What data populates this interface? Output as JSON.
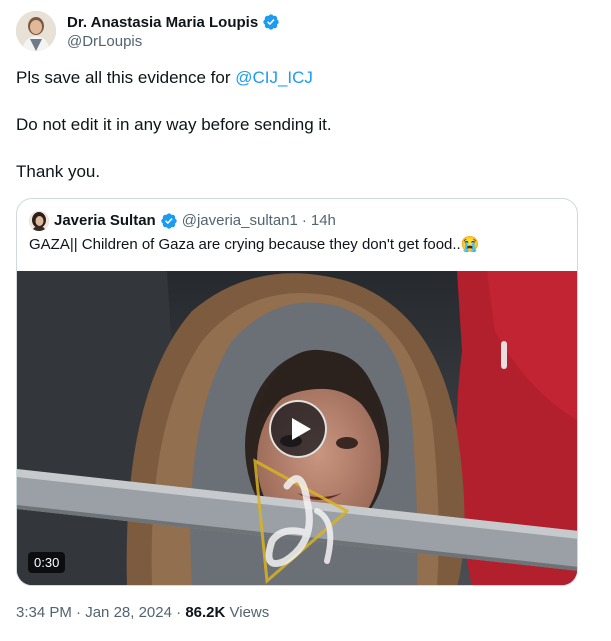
{
  "author": {
    "name": "Dr. Anastasia Maria Loupis",
    "handle": "@DrLoupis",
    "verified": true
  },
  "tweet": {
    "line1_text": "Pls save all this evidence for ",
    "line1_mention": "@CIJ_ICJ",
    "line2": "Do not edit it in any way before sending it.",
    "line3": "Thank you."
  },
  "quoted": {
    "name": "Javeria Sultan",
    "handle": "@javeria_sultan1",
    "dot": "·",
    "time": "14h",
    "text": "GAZA|| Children of Gaza are crying because they don't get food..😭",
    "video_duration": "0:30"
  },
  "meta": {
    "time": "3:34 PM",
    "sep1": "·",
    "date": "Jan 28, 2024",
    "sep2": "·",
    "views_count": "86.2K",
    "views_label": "Views"
  },
  "colors": {
    "accent": "#1d9bf0",
    "text": "#0f1419",
    "secondary": "#536471",
    "border": "#cfd9de"
  },
  "icons": {
    "verified": "verified-badge-icon",
    "play": "play-icon"
  }
}
